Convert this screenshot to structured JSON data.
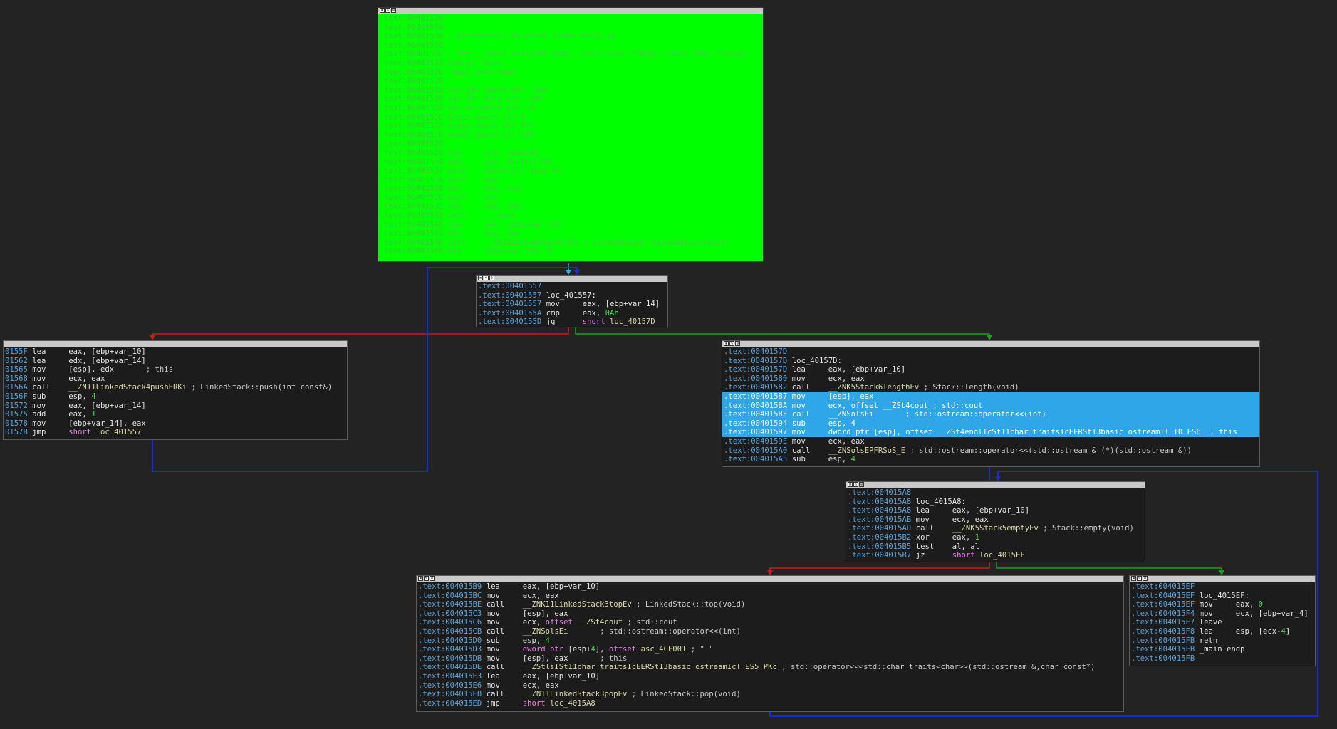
{
  "colors": {
    "background": "#232323",
    "entry_block": "#00ff00",
    "highlight": "#2fa6e8",
    "edge_true": "#1ea01e",
    "edge_false": "#c81e1e",
    "edge_loop": "#1a2dd0",
    "address": "#5da2d6",
    "number": "#4dd24d",
    "keyword": "#e280e2"
  },
  "blocks": {
    "entry": {
      "icons": [
        "graph-icon",
        "edit-icon",
        "zoom-icon"
      ],
      "lines": [
        {
          "addr": ".text:00401530",
          "text": ""
        },
        {
          "addr": ".text:00401530",
          "text": ""
        },
        {
          "addr": ".text:00401530",
          "text": " ; Attributes: bp-based frame fuzzy-sp"
        },
        {
          "addr": ".text:00401530",
          "text": ""
        },
        {
          "addr": ".text:00401530",
          "text": " ; int __cdecl main(int argc, const char **argv, const char **envp)"
        },
        {
          "addr": ".text:00401530",
          "text": " public _main"
        },
        {
          "addr": ".text:00401530",
          "text": " _main proc near"
        },
        {
          "addr": ".text:00401530",
          "text": ""
        },
        {
          "addr": ".text:00401530",
          "text": " var_14= dword ptr -14h"
        },
        {
          "addr": ".text:00401530",
          "text": " var_10= byte ptr -10h"
        },
        {
          "addr": ".text:00401530",
          "text": " var_4= dword ptr -4"
        },
        {
          "addr": ".text:00401530",
          "text": " argc= dword ptr 8"
        },
        {
          "addr": ".text:00401530",
          "text": " argv= dword ptr 0Ch"
        },
        {
          "addr": ".text:00401530",
          "text": " envp= dword ptr 10h"
        },
        {
          "addr": ".text:00401530",
          "text": ""
        },
        {
          "addr": ".text:00401530",
          "text": " lea     ecx, [esp+4]"
        },
        {
          "addr": ".text:00401534",
          "text": " and     esp, 0FFFFFFF0h"
        },
        {
          "addr": ".text:00401537",
          "text": " push    dword ptr [ecx-4]"
        },
        {
          "addr": ".text:0040153A",
          "text": " push    ebp"
        },
        {
          "addr": ".text:0040153B",
          "text": " mov     ebp, esp"
        },
        {
          "addr": ".text:0040153D",
          "text": " push    ecx"
        },
        {
          "addr": ".text:0040153E",
          "text": " sub     esp, 24h"
        },
        {
          "addr": ".text:00401541",
          "text": " call    ___main"
        },
        {
          "addr": ".text:00401546",
          "text": " lea     eax, [ebp+var_10]"
        },
        {
          "addr": ".text:00401549",
          "text": " mov     ecx, eax"
        },
        {
          "addr": ".text:0040154B",
          "text": " call    __ZN11LinkedStackC1Ev ; LinkedStack::LinkedStack(void)"
        },
        {
          "addr": ".text:00401550",
          "text": " mov     [ebp+var_14], 0"
        }
      ]
    },
    "loop_check": {
      "lines": [
        {
          "addr": ".text:00401557",
          "mn": "",
          "ops": ""
        },
        {
          "addr": ".text:00401557",
          "mn": "loc_401557:",
          "ops": ""
        },
        {
          "addr": ".text:00401557",
          "mn": "mov",
          "ops": "eax, [ebp+var_14]"
        },
        {
          "addr": ".text:0040155A",
          "mn": "cmp",
          "ops": "eax, 0Ah"
        },
        {
          "addr": ".text:0040155D",
          "mn": "jg",
          "ops": "short loc_40157D"
        }
      ]
    },
    "push_loop": {
      "lines": [
        {
          "addr": "0155F",
          "mn": "lea",
          "ops": "eax, [ebp+var_10]"
        },
        {
          "addr": "01562",
          "mn": "lea",
          "ops": "edx, [ebp+var_14]"
        },
        {
          "addr": "01565",
          "mn": "mov",
          "ops": "[esp], edx       ; this"
        },
        {
          "addr": "01568",
          "mn": "mov",
          "ops": "ecx, eax"
        },
        {
          "addr": "0156A",
          "mn": "call",
          "ops": "__ZN11LinkedStack4pushERKi ; LinkedStack::push(int const&)"
        },
        {
          "addr": "0156F",
          "mn": "sub",
          "ops": "esp, 4"
        },
        {
          "addr": "01572",
          "mn": "mov",
          "ops": "eax, [ebp+var_14]"
        },
        {
          "addr": "01575",
          "mn": "add",
          "ops": "eax, 1"
        },
        {
          "addr": "01578",
          "mn": "mov",
          "ops": "[ebp+var_14], eax"
        },
        {
          "addr": "0157B",
          "mn": "jmp",
          "ops": "short loc_401557"
        }
      ]
    },
    "print_length": {
      "lines": [
        {
          "addr": ".text:0040157D",
          "mn": "",
          "ops": "",
          "hl": false
        },
        {
          "addr": ".text:0040157D",
          "mn": "loc_40157D:",
          "ops": "",
          "hl": false
        },
        {
          "addr": ".text:0040157D",
          "mn": "lea",
          "ops": "eax, [ebp+var_10]",
          "hl": false
        },
        {
          "addr": ".text:00401580",
          "mn": "mov",
          "ops": "ecx, eax",
          "hl": false
        },
        {
          "addr": ".text:00401582",
          "mn": "call",
          "ops": "__ZNK5Stack6lengthEv ; Stack::length(void)",
          "hl": false
        },
        {
          "addr": ".text:00401587",
          "mn": "mov",
          "ops": "[esp], eax",
          "hl": true
        },
        {
          "addr": ".text:0040158A",
          "mn": "mov",
          "ops": "ecx, offset __ZSt4cout ; std::cout",
          "hl": true
        },
        {
          "addr": ".text:0040158F",
          "mn": "call",
          "ops": "__ZNSolsEi       ; std::ostream::operator<<(int)",
          "hl": true
        },
        {
          "addr": ".text:00401594",
          "mn": "sub",
          "ops": "esp, 4",
          "hl": true
        },
        {
          "addr": ".text:00401597",
          "mn": "mov",
          "ops": "dword ptr [esp], offset __ZSt4endlIcSt11char_traitsIcEERSt13basic_ostreamIT_T0_ES6_ ; this",
          "hl": true
        },
        {
          "addr": ".text:0040159E",
          "mn": "mov",
          "ops": "ecx, eax",
          "hl": false
        },
        {
          "addr": ".text:004015A0",
          "mn": "call",
          "ops": "__ZNSolsEPFRSoS_E ; std::ostream::operator<<(std::ostream & (*)(std::ostream &))",
          "hl": false
        },
        {
          "addr": ".text:004015A5",
          "mn": "sub",
          "ops": "esp, 4",
          "hl": false
        }
      ]
    },
    "empty_check": {
      "lines": [
        {
          "addr": ".text:004015A8",
          "mn": "",
          "ops": ""
        },
        {
          "addr": ".text:004015A8",
          "mn": "loc_4015A8:",
          "ops": ""
        },
        {
          "addr": ".text:004015A8",
          "mn": "lea",
          "ops": "eax, [ebp+var_10]"
        },
        {
          "addr": ".text:004015AB",
          "mn": "mov",
          "ops": "ecx, eax"
        },
        {
          "addr": ".text:004015AD",
          "mn": "call",
          "ops": "__ZNK5Stack5emptyEv ; Stack::empty(void)"
        },
        {
          "addr": ".text:004015B2",
          "mn": "xor",
          "ops": "eax, 1"
        },
        {
          "addr": ".text:004015B5",
          "mn": "test",
          "ops": "al, al"
        },
        {
          "addr": ".text:004015B7",
          "mn": "jz",
          "ops": "short loc_4015EF"
        }
      ]
    },
    "pop_loop": {
      "lines": [
        {
          "addr": ".text:004015B9",
          "mn": "lea",
          "ops": "eax, [ebp+var_10]"
        },
        {
          "addr": ".text:004015BC",
          "mn": "mov",
          "ops": "ecx, eax"
        },
        {
          "addr": ".text:004015BE",
          "mn": "call",
          "ops": "__ZNK11LinkedStack3topEv ; LinkedStack::top(void)"
        },
        {
          "addr": ".text:004015C3",
          "mn": "mov",
          "ops": "[esp], eax"
        },
        {
          "addr": ".text:004015C6",
          "mn": "mov",
          "ops": "ecx, offset __ZSt4cout ; std::cout"
        },
        {
          "addr": ".text:004015CB",
          "mn": "call",
          "ops": "__ZNSolsEi       ; std::ostream::operator<<(int)"
        },
        {
          "addr": ".text:004015D0",
          "mn": "sub",
          "ops": "esp, 4"
        },
        {
          "addr": ".text:004015D3",
          "mn": "mov",
          "ops": "dword ptr [esp+4], offset asc_4CF001 ; \" \""
        },
        {
          "addr": ".text:004015DB",
          "mn": "mov",
          "ops": "[esp], eax       ; this"
        },
        {
          "addr": ".text:004015DE",
          "mn": "call",
          "ops": "__ZStlsISt11char_traitsIcEERSt13basic_ostreamIcT_ES5_PKc ; std::operator<<<std::char_traits<char>>(std::ostream &,char const*)"
        },
        {
          "addr": ".text:004015E3",
          "mn": "lea",
          "ops": "eax, [ebp+var_10]"
        },
        {
          "addr": ".text:004015E6",
          "mn": "mov",
          "ops": "ecx, eax"
        },
        {
          "addr": ".text:004015E8",
          "mn": "call",
          "ops": "__ZN11LinkedStack3popEv ; LinkedStack::pop(void)"
        },
        {
          "addr": ".text:004015ED",
          "mn": "jmp",
          "ops": "short loc_4015A8"
        }
      ]
    },
    "exit": {
      "lines": [
        {
          "addr": ".text:004015EF",
          "mn": "",
          "ops": ""
        },
        {
          "addr": ".text:004015EF",
          "mn": "loc_4015EF:",
          "ops": ""
        },
        {
          "addr": ".text:004015EF",
          "mn": "mov",
          "ops": "eax, 0"
        },
        {
          "addr": ".text:004015F4",
          "mn": "mov",
          "ops": "ecx, [ebp+var_4]"
        },
        {
          "addr": ".text:004015F7",
          "mn": "leave",
          "ops": ""
        },
        {
          "addr": ".text:004015F8",
          "mn": "lea",
          "ops": "esp, [ecx-4]"
        },
        {
          "addr": ".text:004015FB",
          "mn": "retn",
          "ops": ""
        },
        {
          "addr": ".text:004015FB",
          "mn": "_main endp",
          "ops": ""
        },
        {
          "addr": ".text:004015FB",
          "mn": "",
          "ops": ""
        }
      ]
    }
  }
}
